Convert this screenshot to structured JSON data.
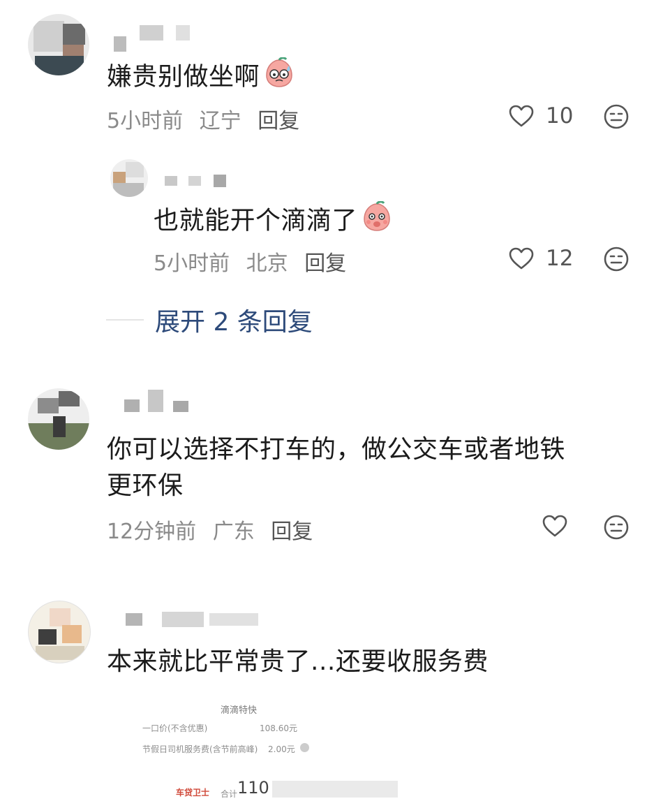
{
  "comments": [
    {
      "text": "嫌贵别做坐啊",
      "time": "5小时前",
      "location": "辽宁",
      "reply_label": "回复",
      "likes": "10",
      "emoji_icon": "sweating-peach-face-icon"
    },
    {
      "text": "也就能开个滴滴了",
      "time": "5小时前",
      "location": "北京",
      "reply_label": "回复",
      "likes": "12",
      "emoji_icon": "shy-peach-face-icon"
    },
    {
      "text_line1": "你可以选择不打车的，做公交车或者地铁",
      "text_line2": "更环保",
      "time": "12分钟前",
      "location": "广东",
      "reply_label": "回复",
      "likes": ""
    },
    {
      "text": "本来就比平常贵了...还要收服务费"
    }
  ],
  "expand_replies": "展开 2 条回复",
  "receipt": {
    "service": "滴滴特快",
    "fixed_price_label": "一口价(不含优惠)",
    "fixed_price": "108.60元",
    "holiday_fee_label": "节假日司机服务费(含节前高峰)",
    "holiday_fee": "2.00元",
    "brand": "车贷卫士",
    "total_label": "合计",
    "total": "110"
  },
  "colors": {
    "text": "#1b1b1b",
    "meta": "#8a8a8a",
    "link": "#2d4a7a",
    "icon": "#555555"
  }
}
